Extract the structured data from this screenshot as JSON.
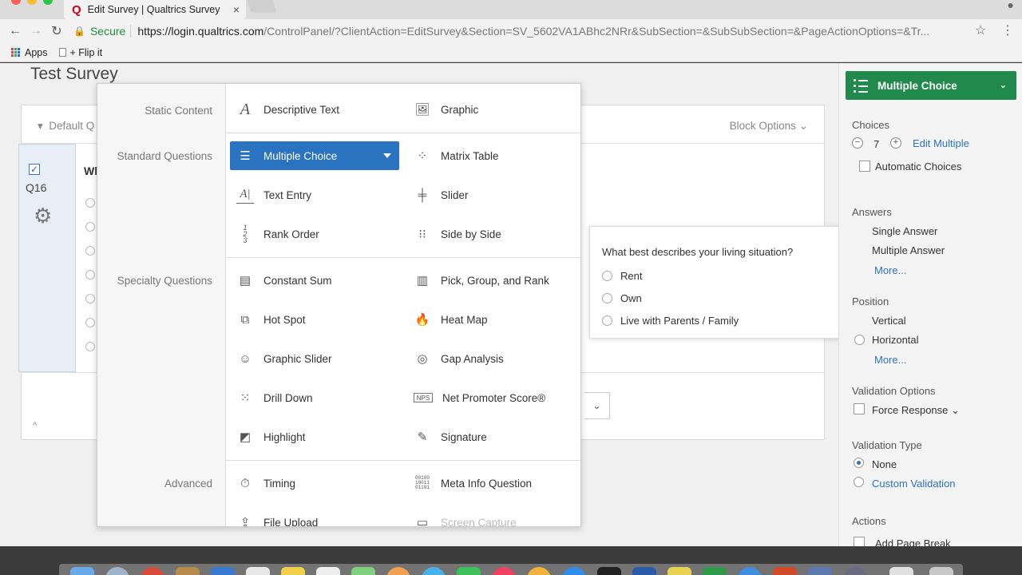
{
  "browser": {
    "tab_title": "Edit Survey | Qualtrics Survey",
    "tab_logo": "Q",
    "secure_label": "Secure",
    "url_host": "https://login.qualtrics.com",
    "url_path": "/ControlPanel/?ClientAction=EditSurvey&Section=SV_5602VA1ABhc2NRr&SubSection=&SubSubSection=&PageActionOptions=&Tr...",
    "bookmarks": [
      {
        "label": "Apps",
        "icon": "apps-grid-icon"
      },
      {
        "label": "+ Flip it",
        "icon": "document-icon"
      }
    ]
  },
  "survey": {
    "title": "Test Survey",
    "block_name": "Default Q",
    "block_options": "Block Options",
    "question_number": "Q16",
    "question_text_stub": "Wh"
  },
  "picker": {
    "categories": [
      {
        "label": "Static Content"
      },
      {
        "label": "Standard Questions"
      },
      {
        "label": "Specialty Questions"
      },
      {
        "label": "Advanced"
      }
    ],
    "items": [
      {
        "label": "Descriptive Text",
        "icon": "descriptive-text-icon"
      },
      {
        "label": "Graphic",
        "icon": "graphic-icon"
      },
      {
        "label": "Multiple Choice",
        "icon": "multiple-choice-icon",
        "selected": true
      },
      {
        "label": "Matrix Table",
        "icon": "matrix-table-icon"
      },
      {
        "label": "Text Entry",
        "icon": "text-entry-icon"
      },
      {
        "label": "Slider",
        "icon": "slider-icon"
      },
      {
        "label": "Rank Order",
        "icon": "rank-order-icon"
      },
      {
        "label": "Side by Side",
        "icon": "side-by-side-icon"
      },
      {
        "label": "Constant Sum",
        "icon": "constant-sum-icon"
      },
      {
        "label": "Pick, Group, and Rank",
        "icon": "pick-group-rank-icon"
      },
      {
        "label": "Hot Spot",
        "icon": "hot-spot-icon"
      },
      {
        "label": "Heat Map",
        "icon": "heat-map-icon"
      },
      {
        "label": "Graphic Slider",
        "icon": "graphic-slider-icon"
      },
      {
        "label": "Gap Analysis",
        "icon": "gap-analysis-icon"
      },
      {
        "label": "Drill Down",
        "icon": "drill-down-icon"
      },
      {
        "label": "Net Promoter Score®",
        "icon": "nps-icon"
      },
      {
        "label": "Highlight",
        "icon": "highlight-icon"
      },
      {
        "label": "Signature",
        "icon": "signature-icon"
      },
      {
        "label": "Timing",
        "icon": "timing-icon"
      },
      {
        "label": "Meta Info Question",
        "icon": "meta-info-icon"
      },
      {
        "label": "File Upload",
        "icon": "file-upload-icon"
      },
      {
        "label": "Screen Capture",
        "icon": "screen-capture-icon"
      }
    ]
  },
  "preview": {
    "question": "What best describes your living situation?",
    "options": [
      "Rent",
      "Own",
      "Live with Parents / Family"
    ]
  },
  "sidebar": {
    "question_type": "Multiple Choice",
    "choices_label": "Choices",
    "choices_count": "7",
    "edit_multiple": "Edit Multiple",
    "automatic_choices": "Automatic Choices",
    "answers_label": "Answers",
    "single_answer": "Single Answer",
    "multiple_answer": "Multiple Answer",
    "more_faded": "More...",
    "position_label": "Position",
    "vertical": "Vertical",
    "horizontal": "Horizontal",
    "more": "More...",
    "validation_options_label": "Validation Options",
    "force_response": "Force Response",
    "validation_type_label": "Validation Type",
    "none": "None",
    "custom_validation": "Custom Validation",
    "actions_label": "Actions",
    "add_page_break": "Add Page Break"
  },
  "colors": {
    "brand_green": "#1f8a4c",
    "selected_blue": "#2a73c0",
    "qualtrics_red": "#d0021b"
  }
}
